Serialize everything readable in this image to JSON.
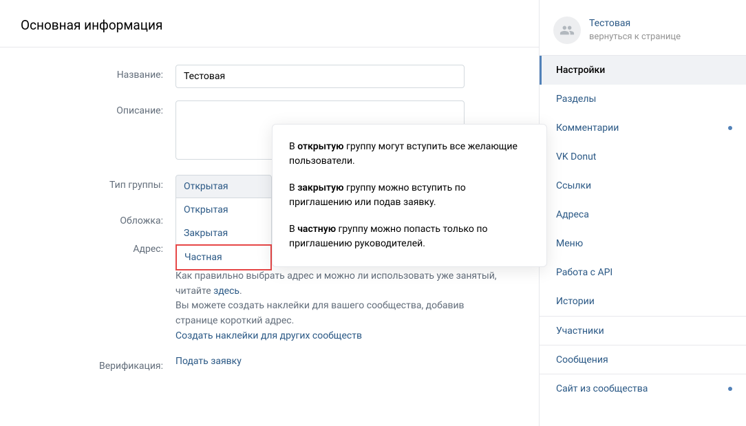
{
  "page": {
    "title": "Основная информация"
  },
  "form": {
    "name_label": "Название:",
    "name_value": "Тестовая",
    "desc_label": "Описание:",
    "desc_value": "",
    "group_type_label": "Тип группы:",
    "group_type_selected": "Открытая",
    "group_type_options": [
      "Открытая",
      "Закрытая",
      "Частная"
    ],
    "cover_label": "Обложка:",
    "address_label": "Адрес:",
    "address_help1a": "Как правильно выбрать адрес и можно ли использовать уже занятый, читайте ",
    "address_help1_link": "здесь",
    "address_help1b": ".",
    "address_help2": "Вы можете создать наклейки для вашего сообщества, добавив странице короткий адрес.",
    "address_stickers_link": "Создать наклейки для других сообществ",
    "verification_label": "Верификация:",
    "verification_link": "Подать заявку"
  },
  "tooltip": {
    "p1a": "В ",
    "p1b": "открытую",
    "p1c": " группу могут вступить все желающие пользователи.",
    "p2a": "В ",
    "p2b": "закрытую",
    "p2c": " группу можно вступить по приглашению или подав заявку.",
    "p3a": "В ",
    "p3b": "частную",
    "p3c": " группу можно попасть только по приглашению руководителей."
  },
  "sidebar": {
    "group_name": "Тестовая",
    "return_text": "вернуться к странице",
    "items": [
      {
        "label": "Настройки",
        "active": true,
        "dot": false
      },
      {
        "label": "Разделы",
        "active": false,
        "dot": false
      },
      {
        "label": "Комментарии",
        "active": false,
        "dot": true
      },
      {
        "label": "VK Donut",
        "active": false,
        "dot": false
      },
      {
        "label": "Ссылки",
        "active": false,
        "dot": false
      },
      {
        "label": "Адреса",
        "active": false,
        "dot": false
      },
      {
        "label": "Меню",
        "active": false,
        "dot": false
      },
      {
        "label": "Работа с API",
        "active": false,
        "dot": false
      },
      {
        "label": "Истории",
        "active": false,
        "dot": false
      },
      {
        "label": "Участники",
        "active": false,
        "dot": false,
        "section": true
      },
      {
        "label": "Сообщения",
        "active": false,
        "dot": false,
        "section": true
      },
      {
        "label": "Сайт из сообщества",
        "active": false,
        "dot": true,
        "section": true
      }
    ]
  }
}
